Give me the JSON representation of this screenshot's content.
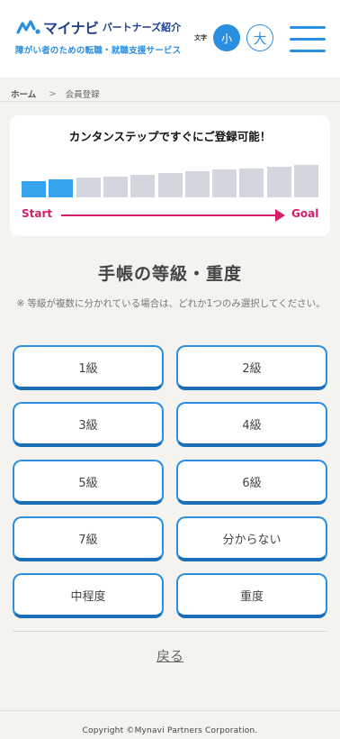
{
  "header": {
    "brand": "マイナビ",
    "brand_sub": "パートナーズ紹介",
    "tagline": "障がい者のための転職・就職支援サービス",
    "font_size_label": "文字",
    "font_small": "小",
    "font_large": "大"
  },
  "breadcrumb": {
    "home": "ホーム",
    "separator": ">",
    "current": "会員登録"
  },
  "progress": {
    "title": "カンタンステップですぐにご登録可能！",
    "completed_steps": 2,
    "total_steps": 11,
    "start_label": "Start",
    "goal_label": "Goal"
  },
  "question": {
    "title": "手帳の等級・重度",
    "note": "※ 等級が複数に分かれている場合は、どれか1つのみ選択してください。"
  },
  "options": [
    "1級",
    "2級",
    "3級",
    "4級",
    "5級",
    "6級",
    "7級",
    "分からない",
    "中程度",
    "重度"
  ],
  "back_link": "戻る",
  "footer": {
    "copyright": "Copyright ©Mynavi Partners Corporation."
  },
  "colors": {
    "accent": "#2a8fe0",
    "brand": "#1f3f8f",
    "progress_done": "#36a3ee",
    "progress_todo": "#d3d6de",
    "start_goal": "#d41e6a"
  }
}
